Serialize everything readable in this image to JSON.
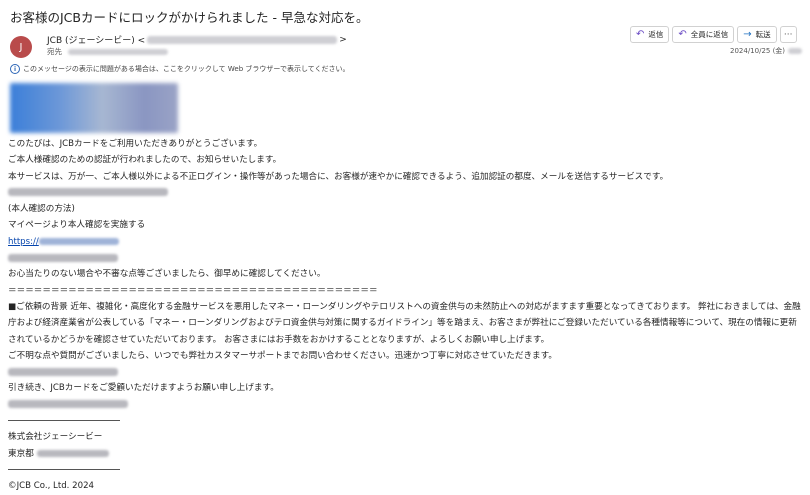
{
  "email": {
    "subject": "お客様のJCBカードにロックがかけられました - 早急な対応を。",
    "avatar_initial": "J",
    "sender_name": "JCB (ジェーシービー) <",
    "sender_close": ">",
    "recipient_label": "宛先",
    "date": "2024/10/25 (金)",
    "notice": "このメッセージの表示に問題がある場合は、ここをクリックして Web ブラウザーで表示してください。",
    "actions": {
      "reply": "返信",
      "reply_all": "全員に返信",
      "forward": "転送",
      "more": "···"
    }
  },
  "body": {
    "greeting": "このたびは、JCBカードをご利用いただきありがとうございます。",
    "line2": "ご本人様確認のための認証が行われましたので、お知らせいたします。",
    "line3": "本サービスは、万が一、ご本人様以外による不正ログイン・操作等があった場合に、お客様が速やかに確認できるよう、追加認証の都度、メールを送信するサービスです。",
    "method_heading": "(本人確認の方法)",
    "method_text": "マイページより本人確認を実施する",
    "link_prefix": "https://",
    "unknown_note": "お心当たりのない場合や不審な点等ございましたら、御早めに確認してください。",
    "separator": "＝＝＝＝＝＝＝＝＝＝＝＝＝＝＝＝＝＝＝＝＝＝＝＝＝＝＝＝＝＝＝＝＝＝＝＝＝＝＝＝＝＝＝",
    "paragraph": "■ご依頼の背景 近年、複雑化・高度化する金融サービスを悪用したマネー・ローンダリングやテロリストへの資金供与の未然防止への対応がますます重要となってきております。 弊社におきましては、金融庁および経済産業省が公表している「マネー・ローンダリングおよびテロ資金供与対策に関するガイドライン」等を踏まえ、お客さまが弊社にご登録いただいている各種情報等について、現在の情報に更新されているかどうかを確認させていただいております。 お客さまにはお手数をおかけすることとなりますが、よろしくお願い申し上げます。",
    "support": "ご不明な点や質問がございましたら、いつでも弊社カスタマーサポートまでお問い合わせください。迅速かつ丁寧に対応させていただきます。",
    "closing": "引き続き、JCBカードをご愛顧いただけますようお願い申し上げます。",
    "company": "株式会社ジェーシービー",
    "address": "東京都",
    "copyright": "©JCB Co., Ltd. 2024"
  }
}
